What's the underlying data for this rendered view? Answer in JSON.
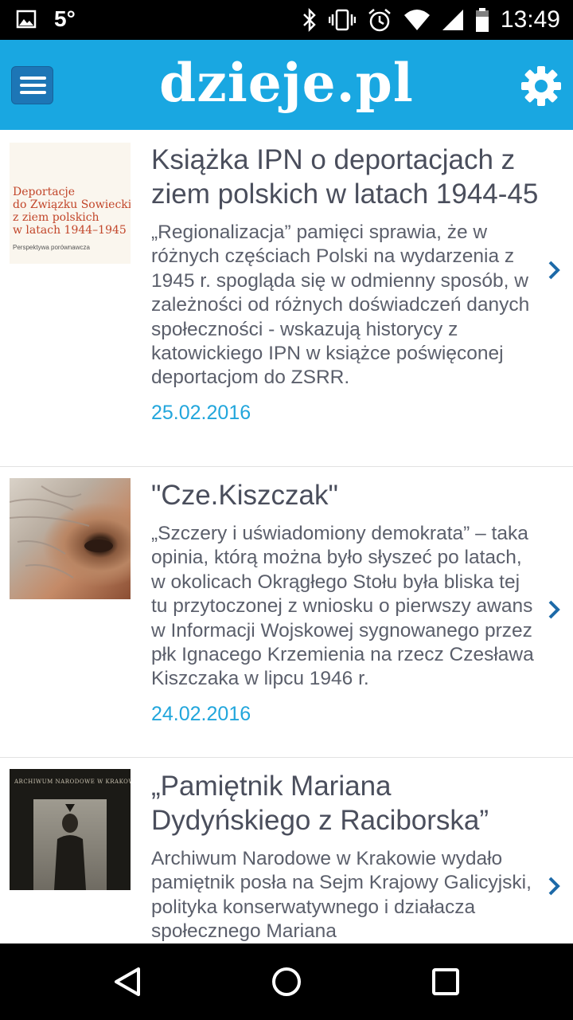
{
  "status_bar": {
    "temperature": "5°",
    "time": "13:49",
    "icons": [
      "image-icon",
      "bluetooth-icon",
      "vibrate-icon",
      "alarm-icon",
      "wifi-icon",
      "signal-icon",
      "battery-icon"
    ]
  },
  "app_bar": {
    "title": "dzieje.pl",
    "accent_color": "#19a7e1",
    "menu_icon": "hamburger-menu-icon",
    "settings_icon": "gear-icon"
  },
  "articles": [
    {
      "title": "Książka IPN o deportacjach z ziem polskich w latach 1944-45",
      "excerpt": "„Regionalizacja” pamięci sprawia, że w różnych częściach Polski na wydarzenia z 1945 r. spogląda się w odmienny sposób, w zależności od różnych doświadczeń danych społeczności - wskazują historycy z katowickiego IPN w książce poświęconej deportacjom do ZSRR.",
      "date": "25.02.2016",
      "thumb_lines": [
        "Deportacje",
        "do Związku Sowieckiego",
        "z ziem polskich",
        "w latach 1944–1945"
      ],
      "thumb_sub": "Perspektywa porównawcza"
    },
    {
      "title": "\"Cze.Kiszczak\"",
      "excerpt": "„Szczery i uświadomiony demokrata” – taka opinia, którą można było słyszeć po latach, w okolicach Okrągłego Stołu była bliska tej tu przytoczonej z wniosku o pierwszy awans  w Informacji Wojskowej sygnowanego przez płk Ignacego Krzemienia na rzecz Czesława Kiszczaka w lipcu 1946 r.",
      "date": "24.02.2016"
    },
    {
      "title": "„Pamiętnik Mariana Dydyńskiego z Raciborska”",
      "excerpt": "Archiwum Narodowe w Krakowie wydało pamiętnik posła na Sejm Krajowy Galicyjski, polityka konserwatywnego i działacza społecznego Mariana",
      "thumb_header": "Archiwum Narodowe w Krakowie"
    }
  ],
  "nav_bar": {
    "icons": [
      "back-icon",
      "home-icon",
      "recents-icon"
    ]
  }
}
